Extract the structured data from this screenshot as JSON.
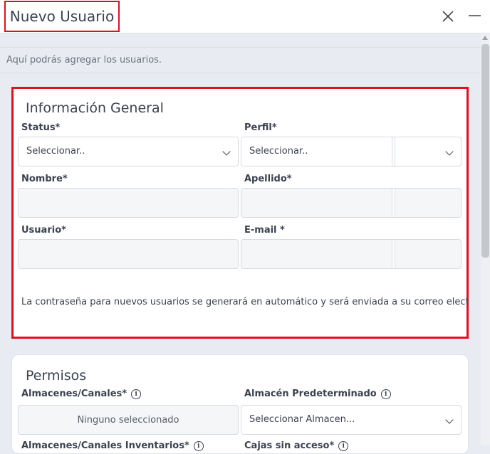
{
  "header": {
    "title": "Nuevo Usuario"
  },
  "subheader": {
    "description": "Aquí podrás agregar los usuarios."
  },
  "general": {
    "title": "Información General",
    "status_label": "Status*",
    "status_value": "Seleccionar..",
    "perfil_label": "Perfil*",
    "perfil_value": "Seleccionar..",
    "nombre_label": "Nombre*",
    "nombre_value": "",
    "apellido_label": "Apellido*",
    "apellido_value": "",
    "usuario_label": "Usuario*",
    "usuario_value": "",
    "email_label": "E-mail *",
    "email_value": "",
    "password_note": "La contraseña para nuevos usuarios se generará en automático y será enviada a su correo electrónico"
  },
  "permisos": {
    "title": "Permisos",
    "almacenes_label": "Almacenes/Canales*",
    "almacenes_value": "Ninguno seleccionado",
    "almacen_pred_label": "Almacén Predeterminado",
    "almacen_pred_value": "Seleccionar Almacen...",
    "almacenes_inv_label": "Almacenes/Canales Inventarios*",
    "cajas_label": "Cajas sin acceso*"
  },
  "colors": {
    "highlight": "#e3101b",
    "background": "#e8ecf2",
    "text": "#3b4250"
  },
  "icons": {
    "close": "close-icon",
    "minimize": "minimize-icon",
    "info": "info-icon",
    "chevron": "chevron-down-icon"
  }
}
